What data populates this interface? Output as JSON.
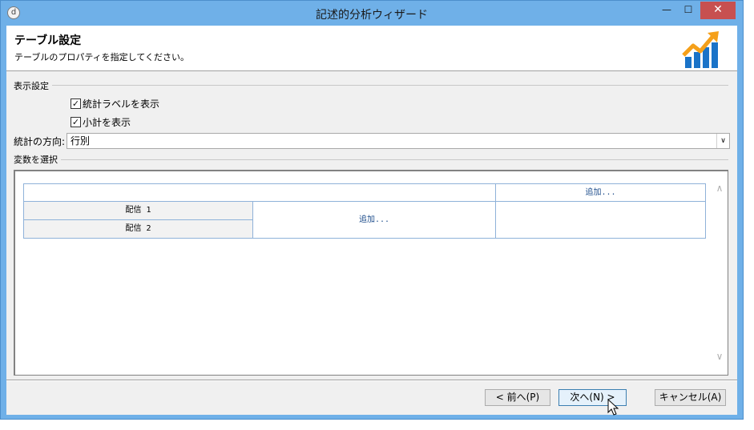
{
  "window": {
    "title": "記述的分析ウィザード",
    "icon_glyph": "d",
    "minimize_glyph": "—",
    "maximize_glyph": "☐",
    "close_glyph": "✕"
  },
  "header": {
    "title": "テーブル設定",
    "subtitle": "テーブルのプロパティを指定してください。"
  },
  "display_settings": {
    "group_label": "表示設定",
    "show_stat_labels": {
      "label": "統計ラベルを表示",
      "checked": true
    },
    "show_subtotals": {
      "label": "小計を表示",
      "checked": true
    },
    "check_glyph": "✓"
  },
  "stat_direction": {
    "label": "統計の方向:",
    "value": "行別",
    "arrow_glyph": "∨"
  },
  "variables": {
    "group_label": "変数を選択",
    "column_add": "追加...",
    "row_1": "配信 1",
    "row_2": "配信 2",
    "row_add": "追加...",
    "scroll_up_glyph": "∧",
    "scroll_down_glyph": "∨"
  },
  "footer": {
    "back_label": "< 前へ(P)",
    "next_label": "次へ(N) >",
    "cancel_label": "キャンセル(A)"
  },
  "colors": {
    "titlebar": "#6fb0e8",
    "close_button": "#c75050",
    "cell_border": "#8fb2d9",
    "logo_orange": "#f5a01a",
    "logo_blue": "#1a73c8"
  },
  "icons": {
    "logo": "trend-chart-icon",
    "cursor": "mouse-pointer-icon"
  }
}
